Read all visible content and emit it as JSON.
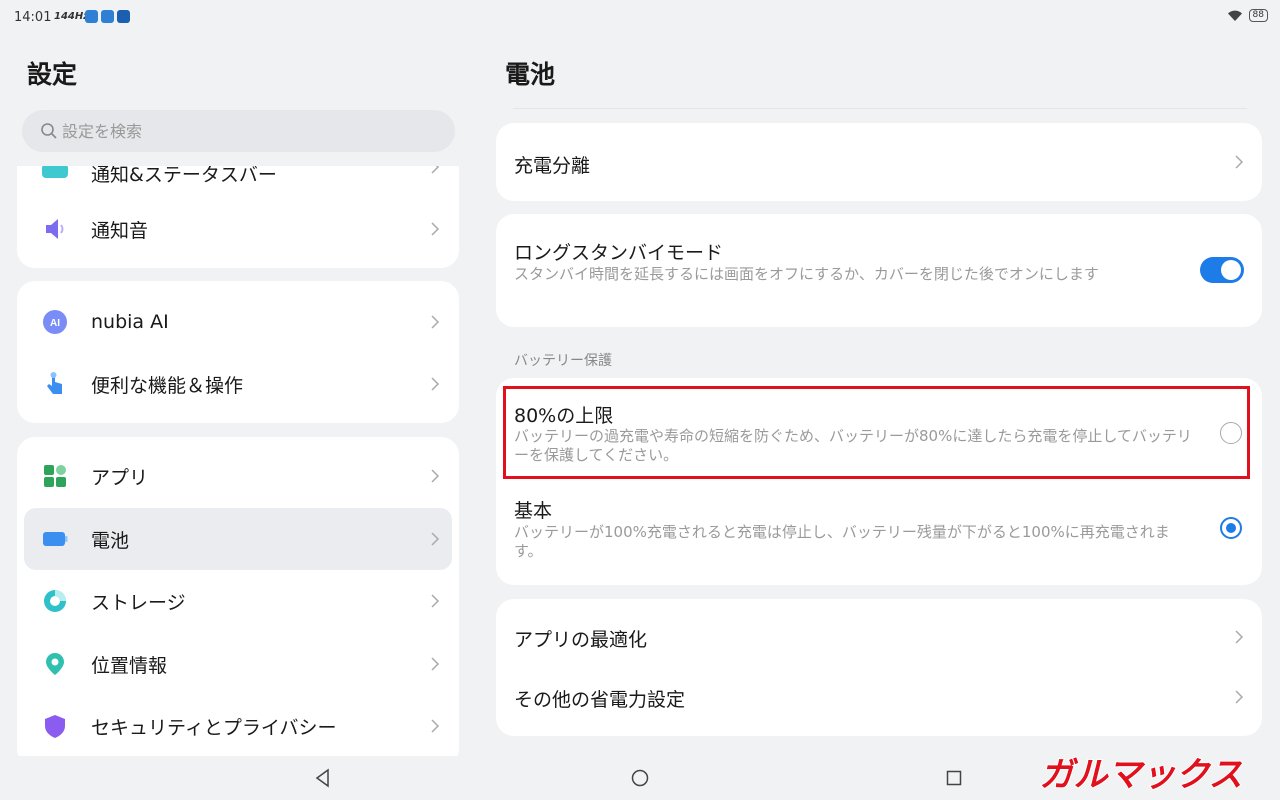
{
  "status": {
    "time": "14:01",
    "refresh": "144Hz",
    "battery": "88"
  },
  "left": {
    "title": "設定",
    "search_placeholder": "設定を検索",
    "partial_item": "通知&ステータスバー",
    "cards": [
      {
        "items": [
          {
            "label": "通知音",
            "icon": "speaker-icon"
          }
        ]
      },
      {
        "items": [
          {
            "label": "nubia AI",
            "icon": "ai-icon"
          },
          {
            "label": "便利な機能＆操作",
            "icon": "gesture-icon"
          }
        ]
      },
      {
        "items": [
          {
            "label": "アプリ",
            "icon": "apps-icon"
          },
          {
            "label": "電池",
            "icon": "battery-icon",
            "selected": true
          },
          {
            "label": "ストレージ",
            "icon": "storage-icon"
          },
          {
            "label": "位置情報",
            "icon": "location-icon"
          },
          {
            "label": "セキュリティとプライバシー",
            "icon": "shield-icon"
          }
        ]
      }
    ]
  },
  "right": {
    "title": "電池",
    "charge_separation": "充電分離",
    "long_standby": {
      "title": "ロングスタンバイモード",
      "subtitle": "スタンバイ時間を延長するには画面をオフにするか、カバーを閉じた後でオンにします",
      "enabled": true
    },
    "section_label": "バッテリー保護",
    "protection_options": [
      {
        "title": "80%の上限",
        "subtitle": "バッテリーの過充電や寿命の短縮を防ぐため、バッテリーが80%に達したら充電を停止してバッテリーを保護してください。",
        "selected": false
      },
      {
        "title": "基本",
        "subtitle": "バッテリーが100%充電されると充電は停止し、バッテリー残量が下がると100%に再充電されます。",
        "selected": true
      }
    ],
    "app_optimization": "アプリの最適化",
    "other_power_saving": "その他の省電力設定"
  },
  "watermark": "ガルマックス",
  "colors": {
    "accent": "#1e7ce8",
    "highlight": "#e0101c",
    "background": "#f1f2f4"
  }
}
